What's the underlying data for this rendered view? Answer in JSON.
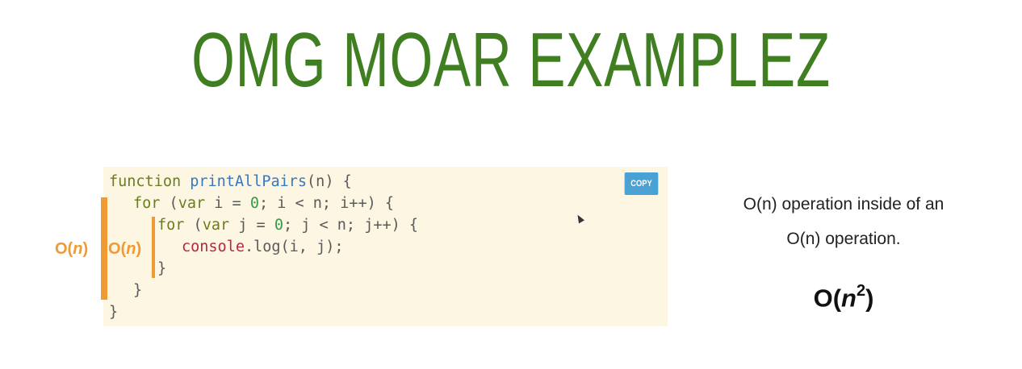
{
  "slide": {
    "title": "OMG MOAR EXAMPLEZ"
  },
  "code": {
    "copy_label": "COPY",
    "line1": {
      "kw": "function",
      "fn": "printAllPairs",
      "rest": "(n) {"
    },
    "line2": {
      "kw1": "for",
      "p1": " (",
      "kw2": "var",
      "p2": " i = ",
      "num": "0",
      "p3": "; i < n; i++) {"
    },
    "line3": {
      "kw1": "for",
      "p1": " (",
      "kw2": "var",
      "p2": " j = ",
      "num": "0",
      "p3": "; j < n; j++) {"
    },
    "line4": {
      "obj": "console",
      "rest": ".log(i, j);"
    },
    "line5": "}",
    "line6": "}",
    "line7": "}"
  },
  "annotations": {
    "outer_o": "O(",
    "outer_n": "n",
    "outer_close": ")",
    "inner_o": "O(",
    "inner_n": "n",
    "inner_close": ")"
  },
  "explanation": {
    "line1": "O(n) operation inside of an",
    "line2": "O(n) operation.",
    "result_o": "O(",
    "result_n": "n",
    "result_exp": "2",
    "result_close": ")"
  },
  "colors": {
    "title": "#3f7f21",
    "accent_orange": "#ef9a33",
    "copy_button": "#4aa1d3",
    "code_bg": "#fcf6e3"
  }
}
